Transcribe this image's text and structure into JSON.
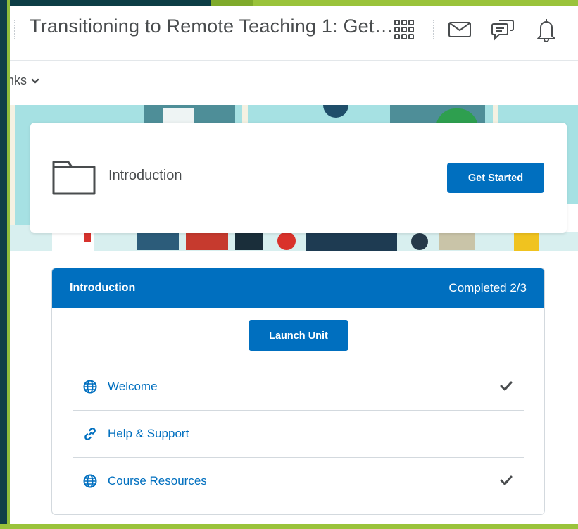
{
  "header": {
    "course_title": "Transitioning to Remote Teaching 1: Get…",
    "icons": [
      "waffle-grid-icon",
      "mail-icon",
      "chat-icon",
      "bell-icon"
    ]
  },
  "navbar": {
    "links_label": "nks"
  },
  "intro_card": {
    "title": "Introduction",
    "get_started_label": "Get Started",
    "icon": "folder-icon"
  },
  "unit": {
    "title": "Introduction",
    "progress": "Completed 2/3",
    "launch_label": "Launch Unit",
    "items": [
      {
        "label": "Welcome",
        "icon": "globe-icon",
        "completed": true
      },
      {
        "label": "Help & Support",
        "icon": "link-icon",
        "completed": false
      },
      {
        "label": "Course Resources",
        "icon": "globe-icon",
        "completed": true
      }
    ]
  },
  "colors": {
    "accent": "#006fbf",
    "frame_green": "#9ac33b",
    "frame_dark": "#0d3d45",
    "banner": "#a8e3e3"
  }
}
